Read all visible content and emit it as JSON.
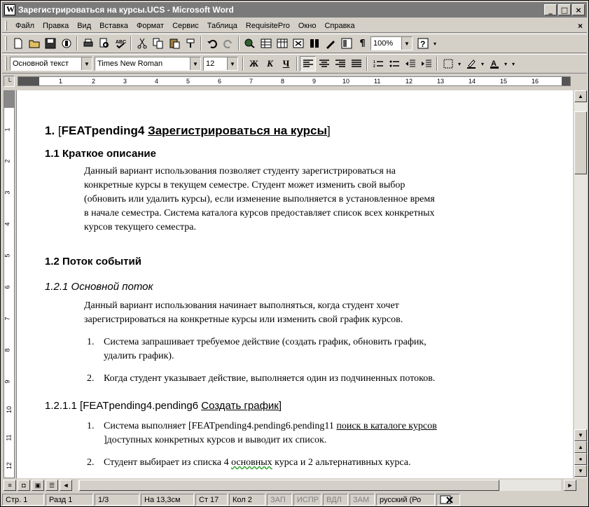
{
  "window": {
    "title": "Зарегистрироваться на курсы.UCS - Microsoft Word",
    "minimize": "_",
    "restore": "□",
    "close": "×"
  },
  "menu": {
    "items": [
      "Файл",
      "Правка",
      "Вид",
      "Вставка",
      "Формат",
      "Сервис",
      "Таблица",
      "RequisitePro",
      "Окно",
      "Справка"
    ],
    "close": "×"
  },
  "toolbar_standard": {
    "zoom": "100%"
  },
  "toolbar_format": {
    "style": "Основной текст",
    "font": "Times New Roman",
    "size": "12"
  },
  "ruler": {
    "ticks": [
      "1",
      "2",
      "3",
      "4",
      "5",
      "6",
      "7",
      "8",
      "9",
      "10",
      "11",
      "12",
      "13",
      "14",
      "15",
      "16"
    ]
  },
  "vruler": {
    "ticks": [
      "1",
      "2",
      "3",
      "4",
      "5",
      "6",
      "7",
      "8",
      "9",
      "10",
      "11",
      "12"
    ]
  },
  "document": {
    "h1_num": "1.",
    "h1_tag": "FEATpending4",
    "h1_link": "Зарегистрироваться на курсы",
    "h2a": "1.1  Краткое описание",
    "para1": [
      "Данный вариант использования позволяет студенту зарегистрироваться на",
      "конкретные курсы в текущем семестре. Студент может изменить свой выбор",
      "(обновить или удалить курсы), если изменение выполняется в установленное время",
      "в начале семестра. Система каталога курсов предоставляет список всех конкретных",
      "курсов текущего семестра."
    ],
    "h2b": "1.2  Поток событий",
    "h3": "1.2.1  Основной поток",
    "para2": [
      "Данный вариант использования начинает выполняться, когда студент хочет",
      "зарегистрироваться на конкретные курсы или изменить свой график курсов."
    ],
    "list1": [
      {
        "num": "1.",
        "lines": [
          "Система запрашивает требуемое действие (создать график, обновить график,",
          "удалить график)."
        ]
      },
      {
        "num": "2.",
        "lines": [
          "Когда студент указывает действие, выполняется один из подчиненных потоков."
        ]
      }
    ],
    "h4_num": "1.2.1.1",
    "h4_tag": "FEATpending4.pending6",
    "h4_link": "Создать график",
    "list2_1_num": "1.",
    "list2_1_pre": "Система выполняет ",
    "list2_1_tag": "FEATpending4.pending6.pending11",
    "list2_1_link": "поиск в каталоге курсов",
    "list2_1_rest": "доступных конкретных курсов и выводит их список.",
    "list2_2_num": "2.",
    "list2_2_pre": "Студент выбирает из списка 4 ",
    "list2_2_wavy": "основных",
    "list2_2_post": " курса и 2 альтернативных курса."
  },
  "statusbar": {
    "page": "Стр. 1",
    "section": "Разд 1",
    "pages": "1/3",
    "position": "На 13,3см",
    "line": "Ст 17",
    "col": "Кол 2",
    "rec": "ЗАП",
    "trk": "ИСПР",
    "ext": "ВДЛ",
    "ovr": "ЗАМ",
    "lang": "русский (Ро"
  }
}
